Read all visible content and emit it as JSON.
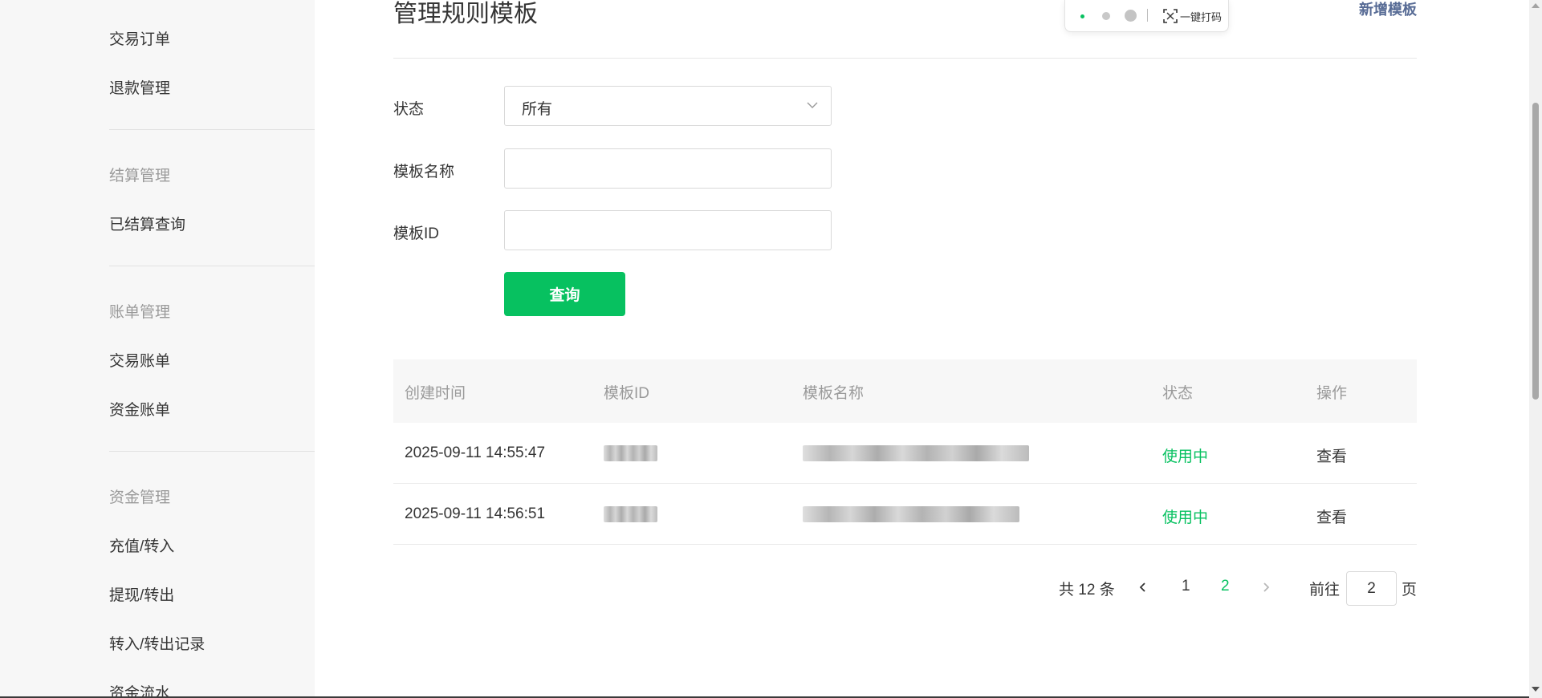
{
  "sidebar": {
    "items": [
      {
        "label": "交易订单",
        "type": "item"
      },
      {
        "label": "退款管理",
        "type": "item"
      },
      {
        "label": "结算管理",
        "type": "group"
      },
      {
        "label": "已结算查询",
        "type": "item"
      },
      {
        "label": "账单管理",
        "type": "group"
      },
      {
        "label": "交易账单",
        "type": "item"
      },
      {
        "label": "资金账单",
        "type": "item"
      },
      {
        "label": "资金管理",
        "type": "group"
      },
      {
        "label": "充值/转入",
        "type": "item"
      },
      {
        "label": "提现/转出",
        "type": "item"
      },
      {
        "label": "转入/转出记录",
        "type": "item"
      },
      {
        "label": "资金流水",
        "type": "item"
      }
    ]
  },
  "header": {
    "title": "管理规则模板",
    "add_label": "新增模板"
  },
  "float_toolbar": {
    "label": "一键打码",
    "icon": "scan-icon"
  },
  "form": {
    "status_label": "状态",
    "status_value": "所有",
    "name_label": "模板名称",
    "name_value": "",
    "id_label": "模板ID",
    "id_value": "",
    "query_label": "查询"
  },
  "table": {
    "columns": [
      "创建时间",
      "模板ID",
      "模板名称",
      "状态",
      "操作"
    ],
    "rows": [
      {
        "created": "2025-09-11 14:55:47",
        "status": "使用中",
        "action": "查看"
      },
      {
        "created": "2025-09-11 14:56:51",
        "status": "使用中",
        "action": "查看"
      }
    ]
  },
  "pagination": {
    "total": "共 12 条",
    "pages": [
      "1",
      "2"
    ],
    "current": "2",
    "goto_label": "前往",
    "goto_value": "2",
    "page_suffix": "页"
  },
  "colors": {
    "accent": "#07c160",
    "link": "#576b95",
    "sidebar_bg": "#f7f7f7"
  }
}
